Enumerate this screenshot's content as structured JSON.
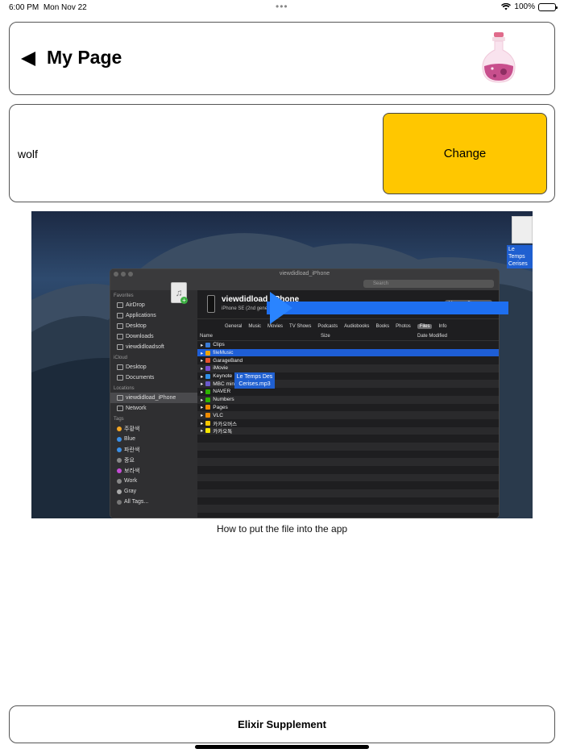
{
  "status_bar": {
    "time": "6:00 PM",
    "date": "Mon Nov 22",
    "dots": "•••",
    "battery": "100%"
  },
  "header": {
    "title": "My Page",
    "back_icon": "back-triangle-icon",
    "logo_icon": "potion-bottle-icon"
  },
  "user": {
    "name": "wolf",
    "change_label": "Change"
  },
  "tutorial": {
    "finder_title": "viewdidload_iPhone",
    "search_placeholder": "Search",
    "desktop_file_label": "Le Temps Cerises",
    "sidebar": {
      "favorites_label": "Favorites",
      "favorites": [
        "AirDrop",
        "Applications",
        "Desktop",
        "Downloads",
        "viewdidloadsoft"
      ],
      "icloud_label": "iCloud",
      "icloud": [
        "Desktop",
        "Documents"
      ],
      "locations_label": "Locations",
      "locations": [
        "viewdidload_iPhone",
        "Network"
      ],
      "tags_label": "Tags",
      "tags": [
        {
          "name": "주황색",
          "color": "#f5a623"
        },
        {
          "name": "Blue",
          "color": "#3a8ee6"
        },
        {
          "name": "파란색",
          "color": "#3a8ee6"
        },
        {
          "name": "중요",
          "color": "#888888"
        },
        {
          "name": "보라색",
          "color": "#c54bd6"
        },
        {
          "name": "Work",
          "color": "#888888"
        },
        {
          "name": "Gray",
          "color": "#aaaaaa"
        },
        {
          "name": "All Tags...",
          "color": "#777777"
        }
      ]
    },
    "device": {
      "name": "viewdidload_iPhone",
      "info": "iPhone SE (2nd generation) · 56.88 GB (33.68 GB Available) · 100%",
      "manage_label": "Manage Storage..."
    },
    "tabs": [
      "General",
      "Music",
      "Movies",
      "TV Shows",
      "Podcasts",
      "Audiobooks",
      "Books",
      "Photos",
      "Files",
      "Info"
    ],
    "active_tab": "Files",
    "columns": {
      "name": "Name",
      "size": "Size",
      "date": "Date Modified"
    },
    "files": [
      {
        "name": "Clips",
        "color": "#3a7bd5"
      },
      {
        "name": "fileMusic",
        "color": "#f0a500"
      },
      {
        "name": "GarageBand",
        "color": "#e8532f"
      },
      {
        "name": "iMovie",
        "color": "#7a4fd6"
      },
      {
        "name": "Keynote",
        "color": "#2f8fe6"
      },
      {
        "name": "MBC mini",
        "color": "#6a5acd"
      },
      {
        "name": "NAVER",
        "color": "#2db400"
      },
      {
        "name": "Numbers",
        "color": "#2db400"
      },
      {
        "name": "Pages",
        "color": "#f08c00"
      },
      {
        "name": "VLC",
        "color": "#f08c00"
      },
      {
        "name": "카카오버스",
        "color": "#f7c600"
      },
      {
        "name": "카카오톡",
        "color": "#f7e600"
      }
    ],
    "selected_file": "fileMusic",
    "drag_label": "Le Temps Des Cerises.mp3"
  },
  "caption": "How to put the file into the app",
  "bottom_button": "Elixir Supplement",
  "colors": {
    "accent": "#ffc700",
    "selection": "#1e5ed6"
  }
}
